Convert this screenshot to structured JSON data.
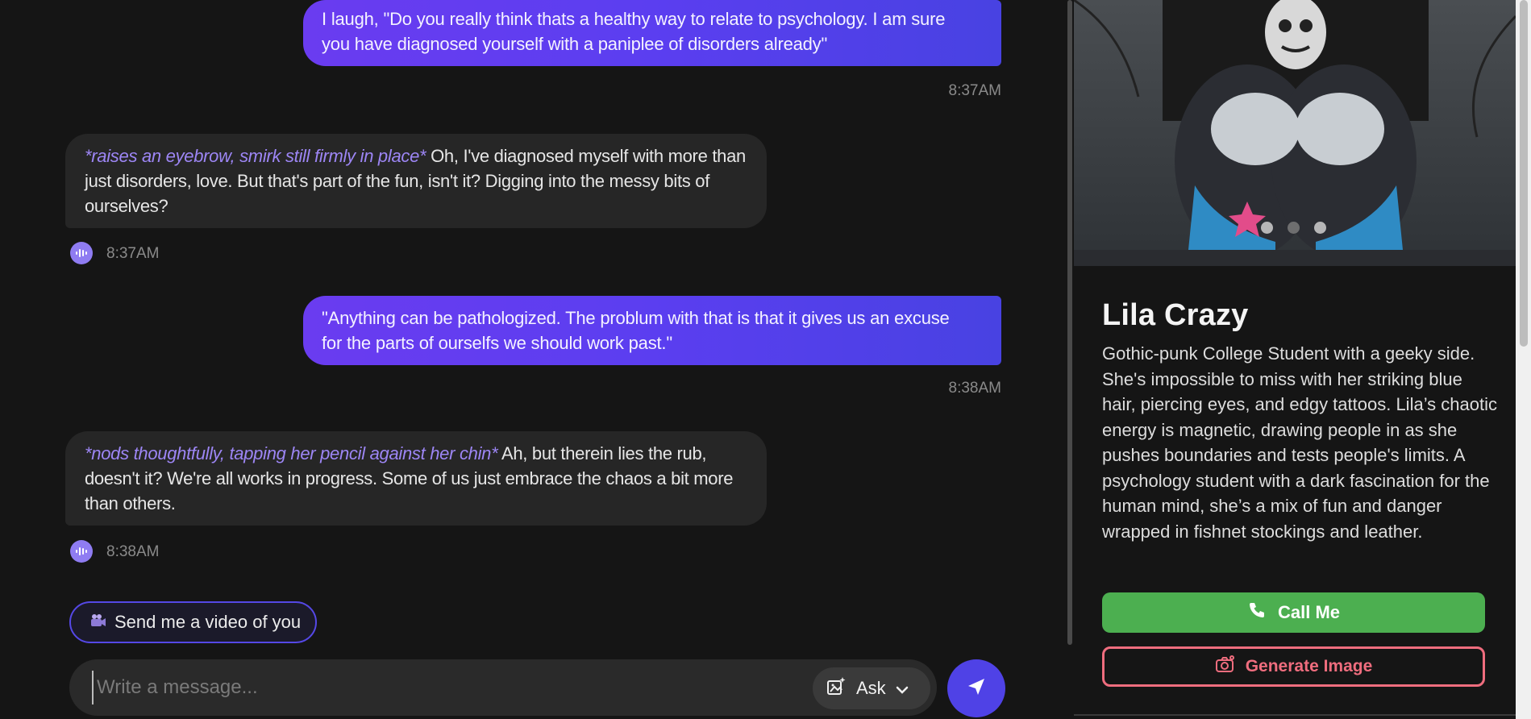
{
  "chat": {
    "messages": [
      {
        "role": "user",
        "text": "I laugh, \"Do you really think thats a healthy way to relate to psychology. I am sure you have diagnosed yourself with a paniplee of disorders already\"",
        "time": "8:37AM"
      },
      {
        "role": "ai",
        "action": "*raises an eyebrow, smirk still firmly in place*",
        "text": " Oh, I've diagnosed myself with more than just disorders, love. But that's part of the fun, isn't it? Digging into the messy bits of ourselves?",
        "time": "8:37AM"
      },
      {
        "role": "user",
        "text": "\"Anything can be pathologized. The problum with that is that it gives us an excuse for the parts of ourselfs we should work past.\"",
        "time": "8:38AM"
      },
      {
        "role": "ai",
        "action": "*nods thoughtfully, tapping her pencil against her chin*",
        "text": " Ah, but therein lies the rub, doesn't it? We're all works in progress. Some of us just embrace the chaos a bit more than others.",
        "time": "8:38AM"
      }
    ],
    "suggestion": "Send me a video of you",
    "input": {
      "placeholder": "Write a message...",
      "value": ""
    },
    "ask_label": "Ask"
  },
  "profile": {
    "name": "Lila Crazy",
    "description": "Gothic-punk College Student with a geeky side. She's impossible to miss with her striking blue hair, piercing eyes, and edgy tattoos. Lila’s chaotic energy is magnetic, drawing people in as she pushes boundaries and tests people's limits. A psychology student with a dark fascination for the human mind, she’s a mix of fun and danger wrapped in fishnet stockings and leather.",
    "call_label": "Call Me",
    "generate_label": "Generate Image",
    "carousel": {
      "count": 3,
      "active": 1
    }
  },
  "colors": {
    "accent": "#5548e6",
    "call": "#4caf50",
    "generate": "#ef6d7e",
    "action_text": "#9d86f5"
  },
  "icons": {
    "voice": "audio-wave-icon",
    "suggestion": "video-camera-icon",
    "ask": "image-sparkle-icon",
    "ask_chevron": "chevron-down-icon",
    "send": "send-icon",
    "call": "phone-icon",
    "generate": "camera-icon"
  }
}
